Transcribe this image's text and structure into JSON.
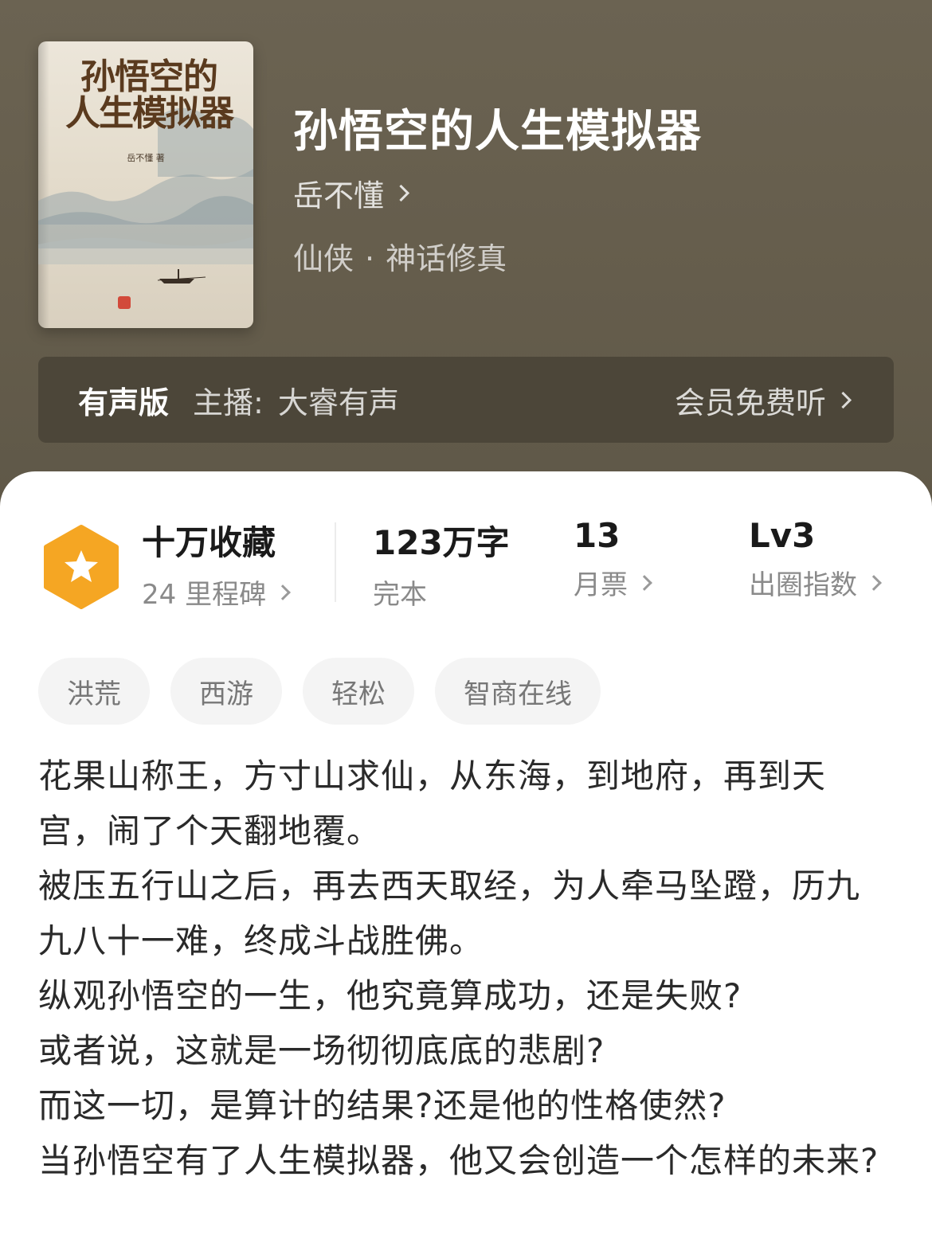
{
  "book": {
    "title": "孙悟空的人生模拟器",
    "author": "岳不懂",
    "category": "仙侠",
    "separator": "·",
    "subcategory": "神话修真",
    "cover": {
      "title_line1": "孙悟空的",
      "title_line2": "人生模拟器",
      "author_credit": "岳不懂 著"
    }
  },
  "audio": {
    "label": "有声版",
    "host_label": "主播:",
    "host": "大睿有声",
    "cta": "会员免费听"
  },
  "stats": {
    "favorites": "十万收藏",
    "milestones": "24 里程碑",
    "word_count": "123万字",
    "status": "完本",
    "monthly_tickets_value": "13",
    "monthly_tickets_label": "月票",
    "level_value": "Lv3",
    "level_label": "出圈指数"
  },
  "tags": [
    "洪荒",
    "西游",
    "轻松",
    "智商在线"
  ],
  "description": [
    "花果山称王，方寸山求仙，从东海，到地府，再到天宫，闹了个天翻地覆。",
    "被压五行山之后，再去西天取经，为人牵马坠蹬，历九九八十一难，终成斗战胜佛。",
    "纵观孙悟空的一生，他究竟算成功，还是失败?",
    "或者说，这就是一场彻彻底底的悲剧?",
    "而这一切，是算计的结果?还是他的性格使然?",
    "当孙悟空有了人生模拟器，他又会创造一个怎样的未来?"
  ],
  "colors": {
    "hero_bg": "#6b6352",
    "audio_bar_bg": "#4c4639",
    "badge_orange": "#f5a623",
    "text_dark": "#2a2a2a",
    "text_muted": "#8a8a8a"
  },
  "icons": {
    "badge": "star-hexagon-icon",
    "chevron": "chevron-right-icon"
  }
}
